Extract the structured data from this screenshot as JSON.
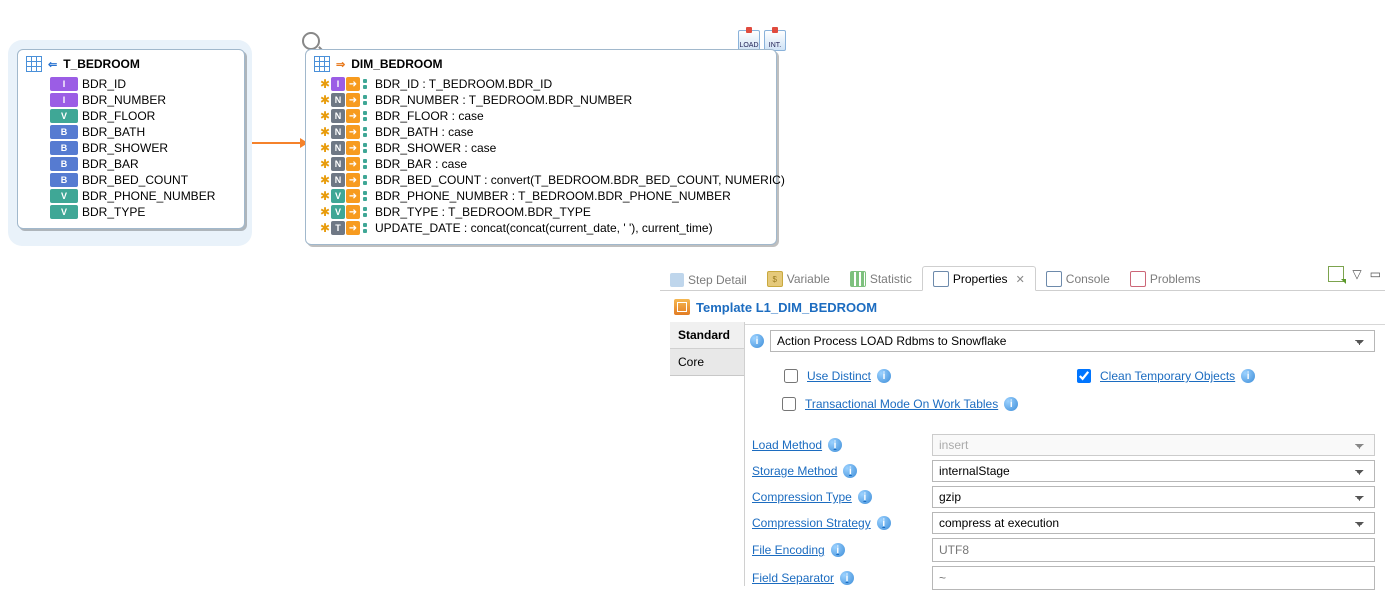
{
  "source": {
    "title": "T_BEDROOM",
    "columns": [
      {
        "name": "BDR_ID",
        "type": "int"
      },
      {
        "name": "BDR_NUMBER",
        "type": "int"
      },
      {
        "name": "BDR_FLOOR",
        "type": "var"
      },
      {
        "name": "BDR_BATH",
        "type": "num"
      },
      {
        "name": "BDR_SHOWER",
        "type": "num"
      },
      {
        "name": "BDR_BAR",
        "type": "num"
      },
      {
        "name": "BDR_BED_COUNT",
        "type": "num"
      },
      {
        "name": "BDR_PHONE_NUMBER",
        "type": "var"
      },
      {
        "name": "BDR_TYPE",
        "type": "var"
      }
    ]
  },
  "target": {
    "title": "DIM_BEDROOM",
    "rows": [
      {
        "letter": "I",
        "letterClass": "bg-violet",
        "text": "BDR_ID : T_BEDROOM.BDR_ID"
      },
      {
        "letter": "N",
        "letterClass": "bg-gray",
        "text": "BDR_NUMBER : T_BEDROOM.BDR_NUMBER"
      },
      {
        "letter": "N",
        "letterClass": "bg-gray",
        "text": "BDR_FLOOR : case"
      },
      {
        "letter": "N",
        "letterClass": "bg-gray",
        "text": "BDR_BATH : case"
      },
      {
        "letter": "N",
        "letterClass": "bg-gray",
        "text": "BDR_SHOWER : case"
      },
      {
        "letter": "N",
        "letterClass": "bg-gray",
        "text": "BDR_BAR : case"
      },
      {
        "letter": "N",
        "letterClass": "bg-gray",
        "text": "BDR_BED_COUNT : convert(T_BEDROOM.BDR_BED_COUNT, NUMERIC)"
      },
      {
        "letter": "V",
        "letterClass": "bg-green",
        "text": "BDR_PHONE_NUMBER : T_BEDROOM.BDR_PHONE_NUMBER"
      },
      {
        "letter": "V",
        "letterClass": "bg-green",
        "text": "BDR_TYPE : T_BEDROOM.BDR_TYPE"
      },
      {
        "letter": "T",
        "letterClass": "bg-gray",
        "text": "UPDATE_DATE : concat(concat(current_date, ' '), current_time)"
      }
    ]
  },
  "toolbar": {
    "load": "LOAD",
    "int": "INT."
  },
  "tabs": {
    "step": "Step Detail",
    "variable": "Variable",
    "statistic": "Statistic",
    "properties": "Properties",
    "console": "Console",
    "problems": "Problems"
  },
  "template": {
    "title": "Template L1_DIM_BEDROOM",
    "left_tabs": {
      "standard": "Standard",
      "core": "Core"
    }
  },
  "form": {
    "action_process": "Action Process LOAD Rdbms to Snowflake",
    "checks": {
      "use_distinct": {
        "label": "Use Distinct",
        "checked": false
      },
      "clean_temp": {
        "label": "Clean Temporary Objects",
        "checked": true
      },
      "trans_mode": {
        "label": "Transactional Mode On Work Tables",
        "checked": false
      }
    },
    "rows": [
      {
        "label": "Load Method",
        "type": "select",
        "value": "insert",
        "disabled": true
      },
      {
        "label": "Storage Method",
        "type": "select",
        "value": "internalStage",
        "disabled": false
      },
      {
        "label": "Compression Type",
        "type": "select",
        "value": "gzip",
        "disabled": false
      },
      {
        "label": "Compression Strategy",
        "type": "select",
        "value": "compress at execution",
        "disabled": false
      },
      {
        "label": "File Encoding",
        "type": "text",
        "value": "UTF8"
      },
      {
        "label": "Field Separator",
        "type": "text",
        "value": "~"
      }
    ]
  }
}
